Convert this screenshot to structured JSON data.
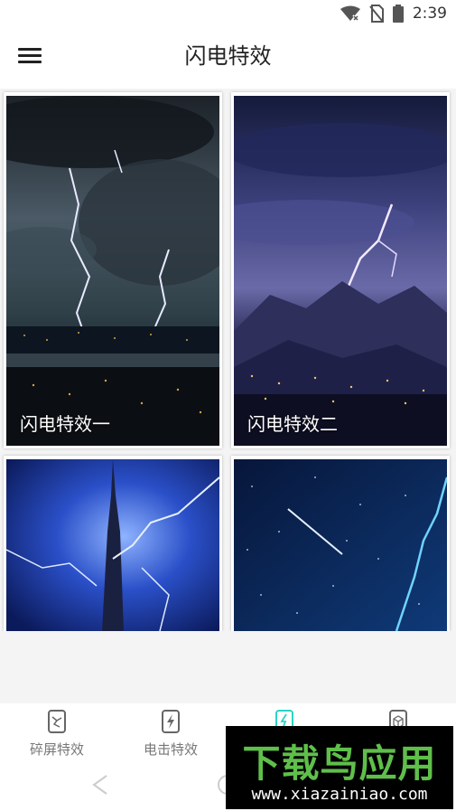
{
  "status_bar": {
    "time": "2:39"
  },
  "app_bar": {
    "title": "闪电特效"
  },
  "cards": [
    {
      "label": "闪电特效一"
    },
    {
      "label": "闪电特效二"
    },
    {
      "label": ""
    },
    {
      "label": ""
    }
  ],
  "tabs": [
    {
      "label": "碎屏特效",
      "icon": "broken-screen-icon"
    },
    {
      "label": "电击特效",
      "icon": "electric-shock-icon"
    },
    {
      "label": "",
      "icon": "lightning-phone-icon",
      "active": true
    },
    {
      "label": "",
      "icon": "box-phone-icon"
    }
  ],
  "watermark": {
    "brand": "下载鸟应用",
    "url": "www.xiazainiao.com"
  },
  "colors": {
    "accent": "#2ad4c4"
  }
}
